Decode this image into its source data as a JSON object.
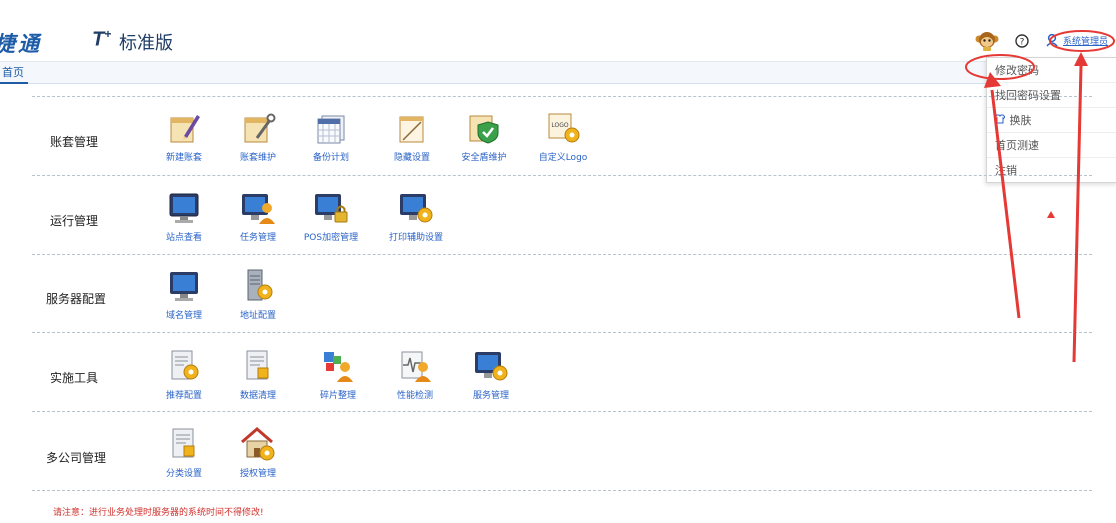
{
  "header": {
    "logo_cn": "捷通",
    "logo_t": "T",
    "logo_plus": "+",
    "edition": "标准版",
    "user_link": "系统管理员"
  },
  "tabs": {
    "home": "首页"
  },
  "dropdown": [
    {
      "label": "修改密码",
      "icon": ""
    },
    {
      "label": "找回密码设置",
      "icon": ""
    },
    {
      "label": "换肤",
      "icon": "shirt-icon"
    },
    {
      "label": "首页测速",
      "icon": ""
    },
    {
      "label": "注销",
      "icon": ""
    }
  ],
  "sections": [
    {
      "label": "账套管理",
      "items": [
        "新建账套",
        "账套维护",
        "备份计划",
        "隐藏设置",
        "安全盾维护",
        "自定义Logo"
      ]
    },
    {
      "label": "运行管理",
      "items": [
        "站点查看",
        "任务管理",
        "POS加密管理",
        "打印辅助设置"
      ]
    },
    {
      "label": "服务器配置",
      "items": [
        "域名管理",
        "地址配置"
      ]
    },
    {
      "label": "实施工具",
      "items": [
        "推荐配置",
        "数据清理",
        "碎片整理",
        "性能检测",
        "服务管理"
      ]
    },
    {
      "label": "多公司管理",
      "items": [
        "分类设置",
        "授权管理"
      ]
    }
  ],
  "notice": "请注意：进行业务处理时服务器的系统时间不得修改!",
  "colors": {
    "accent": "#1e5ca8",
    "link": "#2a63c7",
    "annotation": "#e53935",
    "notice": "#d0312d"
  }
}
